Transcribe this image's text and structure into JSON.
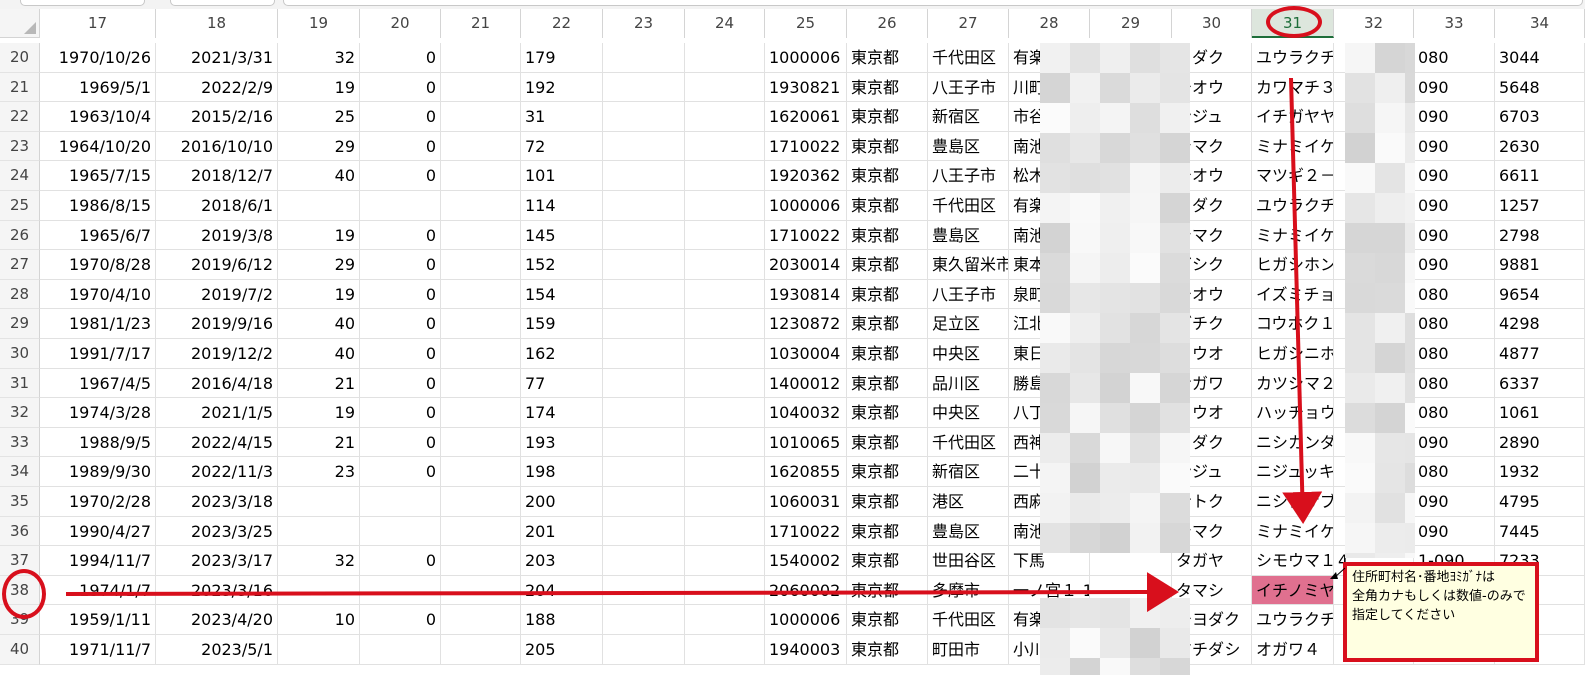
{
  "columns": [
    "17",
    "18",
    "19",
    "20",
    "21",
    "22",
    "23",
    "24",
    "25",
    "26",
    "27",
    "28",
    "29",
    "30",
    "31",
    "32",
    "33",
    "34"
  ],
  "selected_column": "31",
  "rows": [
    {
      "n": "20",
      "c17": "1970/10/26",
      "c18": "2021/3/31",
      "c19": "32",
      "c20": "0",
      "c22": "179",
      "c25": "1000006",
      "c26": "東京都",
      "c27": "千代田区",
      "c28": "有楽",
      "c30": "ヨダク",
      "c31": "ユウラクチ",
      "c33": "080",
      "c34": "3044"
    },
    {
      "n": "21",
      "c17": "1969/5/1",
      "c18": "2022/2/9",
      "c19": "19",
      "c20": "0",
      "c22": "192",
      "c25": "1930821",
      "c26": "東京都",
      "c27": "八王子市",
      "c28": "川町",
      "c30": "チオウ",
      "c31": "カワマチ３",
      "c33": "090",
      "c34": "5648"
    },
    {
      "n": "22",
      "c17": "1963/10/4",
      "c18": "2015/2/16",
      "c19": "25",
      "c20": "0",
      "c22": "31",
      "c25": "1620061",
      "c26": "東京都",
      "c27": "新宿区",
      "c28": "市谷",
      "c30": "ンジュ",
      "c31": "イチガヤヤ",
      "c33": "090",
      "c34": "6703"
    },
    {
      "n": "23",
      "c17": "1964/10/20",
      "c18": "2016/10/10",
      "c19": "29",
      "c20": "0",
      "c22": "72",
      "c25": "1710022",
      "c26": "東京都",
      "c27": "豊島区",
      "c28": "南池",
      "c30": "シマク",
      "c31": "ミナミイケ",
      "c33": "090",
      "c34": "2630"
    },
    {
      "n": "24",
      "c17": "1965/7/15",
      "c18": "2018/12/7",
      "c19": "40",
      "c20": "0",
      "c22": "101",
      "c25": "1920362",
      "c26": "東京都",
      "c27": "八王子市",
      "c28": "松木",
      "c30": "チオウ",
      "c31": "マツギ２－",
      "c33": "090",
      "c34": "6611"
    },
    {
      "n": "25",
      "c17": "1986/8/15",
      "c18": "2018/6/1",
      "c19": "",
      "c20": "",
      "c22": "114",
      "c25": "1000006",
      "c26": "東京都",
      "c27": "千代田区",
      "c28": "有楽",
      "c30": "ヨダク",
      "c31": "ユウラクチ",
      "c33": "090",
      "c34": "1257"
    },
    {
      "n": "26",
      "c17": "1965/6/7",
      "c18": "2019/3/8",
      "c19": "19",
      "c20": "0",
      "c22": "145",
      "c25": "1710022",
      "c26": "東京都",
      "c27": "豊島区",
      "c28": "南池",
      "c30": "シマク",
      "c31": "ミナミイケ",
      "c33": "090",
      "c34": "2798"
    },
    {
      "n": "27",
      "c17": "1970/8/28",
      "c18": "2019/6/12",
      "c19": "29",
      "c20": "0",
      "c22": "152",
      "c25": "2030014",
      "c26": "東京都",
      "c27": "東久留米市",
      "c28": "東本",
      "c30": "ガシク",
      "c31": "ヒガシホン",
      "c33": "090",
      "c34": "9881"
    },
    {
      "n": "28",
      "c17": "1970/4/10",
      "c18": "2019/7/2",
      "c19": "19",
      "c20": "0",
      "c22": "154",
      "c25": "1930814",
      "c26": "東京都",
      "c27": "八王子市",
      "c28": "泉町",
      "c30": "チオウ",
      "c31": "イズミチョ",
      "c33": "080",
      "c34": "9654"
    },
    {
      "n": "29",
      "c17": "1981/1/23",
      "c18": "2019/9/16",
      "c19": "40",
      "c20": "0",
      "c22": "159",
      "c25": "1230872",
      "c26": "東京都",
      "c27": "足立区",
      "c28": "江北",
      "c30": "ダチク",
      "c31": "コウホク１",
      "c33": "080",
      "c34": "4298"
    },
    {
      "n": "30",
      "c17": "1991/7/17",
      "c18": "2019/12/2",
      "c19": "40",
      "c20": "0",
      "c22": "162",
      "c25": "1030004",
      "c26": "東京都",
      "c27": "中央区",
      "c28": "東日",
      "c30": "ュウオ",
      "c31": "ヒガシニホ",
      "c33": "080",
      "c34": "4877"
    },
    {
      "n": "31",
      "c17": "1967/4/5",
      "c18": "2016/4/18",
      "c19": "21",
      "c20": "0",
      "c22": "77",
      "c25": "1400012",
      "c26": "東京都",
      "c27": "品川区",
      "c28": "勝島",
      "c30": "ナガワ",
      "c31": "カツシマ２",
      "c33": "080",
      "c34": "6337"
    },
    {
      "n": "32",
      "c17": "1974/3/28",
      "c18": "2021/1/5",
      "c19": "19",
      "c20": "0",
      "c22": "174",
      "c25": "1040032",
      "c26": "東京都",
      "c27": "中央区",
      "c28": "八丁",
      "c30": "ュウオ",
      "c31": "ハッチョウ",
      "c33": "080",
      "c34": "1061"
    },
    {
      "n": "33",
      "c17": "1988/9/5",
      "c18": "2022/4/15",
      "c19": "21",
      "c20": "0",
      "c22": "193",
      "c25": "1010065",
      "c26": "東京都",
      "c27": "千代田区",
      "c28": "西神",
      "c30": "ヨダク",
      "c31": "ニシカンダ",
      "c33": "090",
      "c34": "2890"
    },
    {
      "n": "34",
      "c17": "1989/9/30",
      "c18": "2022/11/3",
      "c19": "23",
      "c20": "0",
      "c22": "198",
      "c25": "1620855",
      "c26": "東京都",
      "c27": "新宿区",
      "c28": "二十",
      "c30": "ンジュ",
      "c31": "ニジュッキ",
      "c33": "080",
      "c34": "1932"
    },
    {
      "n": "35",
      "c17": "1970/2/28",
      "c18": "2023/3/18",
      "c19": "",
      "c20": "",
      "c22": "200",
      "c25": "1060031",
      "c26": "東京都",
      "c27": "港区",
      "c28": "西麻",
      "c30": "ナトク",
      "c31": "ニシアザブ",
      "c33": "090",
      "c34": "4795"
    },
    {
      "n": "36",
      "c17": "1990/4/27",
      "c18": "2023/3/25",
      "c19": "",
      "c20": "",
      "c22": "201",
      "c25": "1710022",
      "c26": "東京都",
      "c27": "豊島区",
      "c28": "南池",
      "c30": "シマク",
      "c31": "ミナミイケ",
      "c33": "090",
      "c34": "7445"
    },
    {
      "n": "37",
      "c17": "1994/11/7",
      "c18": "2023/3/17",
      "c19": "32",
      "c20": "0",
      "c22": "203",
      "c25": "1540002",
      "c26": "東京都",
      "c27": "世田谷区",
      "c28": "下馬",
      "c30": "タガヤ",
      "c31": "シモウマ１",
      "c32": "4",
      "c33": "1-090",
      "c34": "7233"
    },
    {
      "n": "38",
      "c17": "1974/1/7",
      "c18": "2023/3/16",
      "c19": "",
      "c20": "",
      "c22": "204",
      "c25": "2060002",
      "c26": "東京都",
      "c27": "多摩市",
      "c28": "一ノ宮１-18ゲート",
      "c30": "タマシ",
      "c31": "イチノミヤ",
      "c33": "",
      "c34": ""
    },
    {
      "n": "39",
      "c17": "1959/1/11",
      "c18": "2023/4/20",
      "c19": "10",
      "c20": "0",
      "c22": "188",
      "c25": "1000006",
      "c26": "東京都",
      "c27": "千代田区",
      "c28": "有楽",
      "c30": "チヨダク",
      "c31": "ユウラクチ",
      "c33": "",
      "c34": ""
    },
    {
      "n": "40",
      "c17": "1971/11/7",
      "c18": "2023/5/1",
      "c19": "",
      "c20": "",
      "c22": "205",
      "c25": "1940003",
      "c26": "東京都",
      "c27": "町田市",
      "c28": "小川",
      "c30": "マチダシ",
      "c31": "オガワ４",
      "c33": "",
      "c34": ""
    }
  ],
  "comment": {
    "lines": [
      "住所町村名･番地ﾖﾐｶﾞﾅは",
      "全角カナもしくは数値-のみで",
      "指定してください"
    ]
  },
  "colors": {
    "annotation": "#d80f1c",
    "highlight_cell": "#e0708f",
    "comment_bg": "#ffffe1",
    "selected_header": "#1e6e3a"
  },
  "redactions": [
    "blurred address columns 28-29",
    "blurred column 32",
    "blurred column 33 prefix"
  ]
}
